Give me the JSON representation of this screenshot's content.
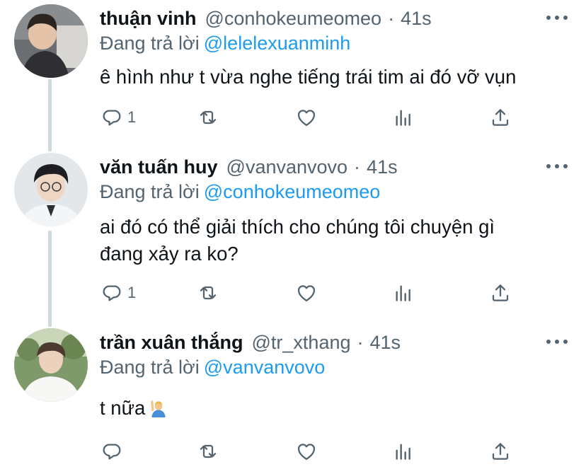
{
  "tweets": [
    {
      "name": "thuận vinh",
      "handle": "@conhokeumeomeo",
      "separator": "·",
      "time": "41s",
      "replying_prefix": "Đang trả lời",
      "replying_to": "@lelelexuanminh",
      "text_lines": [
        "ê hình như t vừa nghe tiếng trái tim ai đó vỡ vụn"
      ],
      "reply_count": "1",
      "avatar_icon": "avatar-photo"
    },
    {
      "name": "văn tuấn huy",
      "handle": "@vanvanvovo",
      "separator": "·",
      "time": "41s",
      "replying_prefix": "Đang trả lời",
      "replying_to": "@conhokeumeomeo",
      "text_lines": [
        "ai đó có thể giải thích cho chúng tôi chuyện gì",
        "đang xảy ra ko?"
      ],
      "reply_count": "1",
      "avatar_icon": "avatar-photo"
    },
    {
      "name": "trần xuân thắng",
      "handle": "@tr_xthang",
      "separator": "·",
      "time": "41s",
      "replying_prefix": "Đang trả lời",
      "replying_to": "@vanvanvovo",
      "text_lines": [
        "t nữa"
      ],
      "emoji": "man-raising-hand-emoji",
      "reply_count": "",
      "avatar_icon": "avatar-photo"
    }
  ],
  "colors": {
    "text": "#0f1419",
    "secondary": "#536471",
    "link": "#1d9bf0",
    "thread_line": "#cfd9de"
  },
  "action_icons": [
    "reply-icon",
    "retweet-icon",
    "like-icon",
    "analytics-icon",
    "share-icon"
  ]
}
